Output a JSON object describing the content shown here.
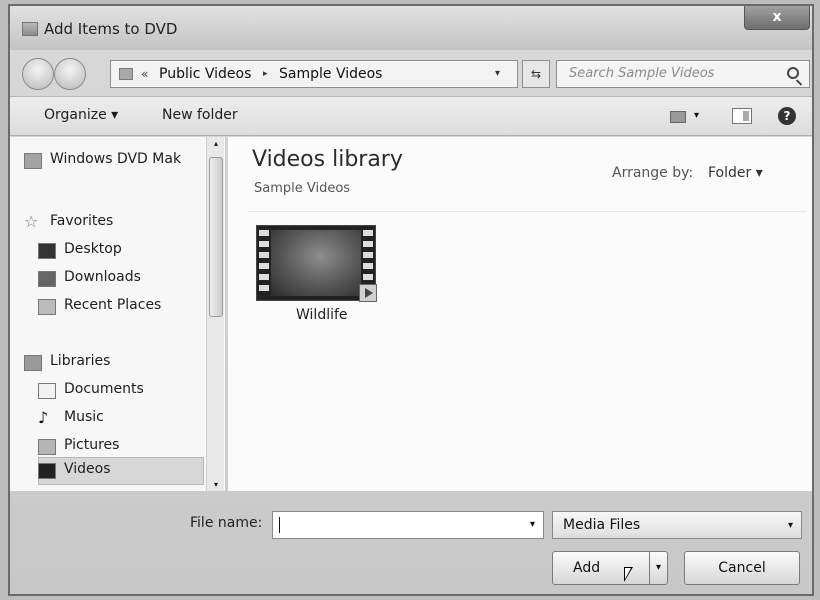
{
  "window": {
    "title": "Add Items to DVD",
    "close_glyph": "x"
  },
  "address_bar": {
    "chevron": "«",
    "crumbs": [
      "Public Videos",
      "Sample Videos"
    ],
    "separator": "▸",
    "dropdown_glyph": "▾",
    "refresh_glyph": "⇆"
  },
  "search": {
    "placeholder": "Search Sample Videos"
  },
  "toolbar": {
    "organize_label": "Organize ▾",
    "new_folder_label": "New folder",
    "help_glyph": "?"
  },
  "nav_pane": {
    "items": [
      {
        "label": "Windows DVD Mak",
        "icon": "dvd-maker-icon"
      },
      {
        "label": "Favorites",
        "icon": "star-icon"
      },
      {
        "label": "Desktop",
        "icon": "desktop-icon"
      },
      {
        "label": "Downloads",
        "icon": "downloads-icon"
      },
      {
        "label": "Recent Places",
        "icon": "recent-places-icon"
      },
      {
        "label": "Libraries",
        "icon": "libraries-icon"
      },
      {
        "label": "Documents",
        "icon": "documents-icon"
      },
      {
        "label": "Music",
        "icon": "music-icon"
      },
      {
        "label": "Pictures",
        "icon": "pictures-icon"
      },
      {
        "label": "Videos",
        "icon": "videos-icon"
      }
    ],
    "selected": "Videos",
    "scroll_up_glyph": "▴",
    "scroll_down_glyph": "▾"
  },
  "content": {
    "library_title": "Videos library",
    "library_subtitle": "Sample Videos",
    "arrange_label": "Arrange by:",
    "arrange_value": "Folder ▾",
    "files": [
      {
        "name": "Wildlife",
        "icon": "video-thumbnail-icon"
      }
    ]
  },
  "file_name": {
    "label": "File name:",
    "value": "",
    "dropdown_glyph": "▾"
  },
  "file_type": {
    "value": "Media Files",
    "dropdown_glyph": "▾"
  },
  "buttons": {
    "add_label": "Add",
    "add_split_glyph": "▾",
    "cancel_label": "Cancel"
  },
  "colors": {
    "window_frame": "#6b6b6b",
    "selection": "#d7d7d7"
  }
}
